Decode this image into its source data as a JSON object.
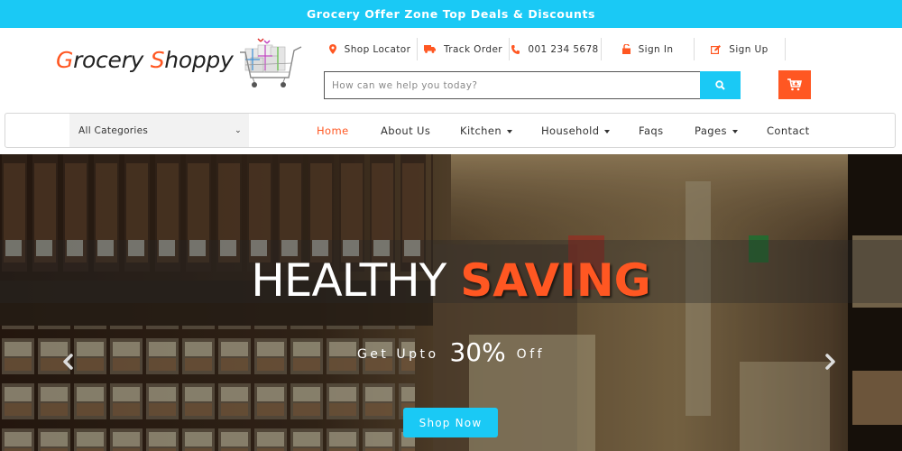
{
  "offer_bar": {
    "text": "Grocery Offer Zone Top Deals & Discounts"
  },
  "header": {
    "logo": {
      "first_initial": "G",
      "first_rest": "rocery ",
      "second_initial": "S",
      "second_rest": "hoppy",
      "icon": "shopping-cart-gifts-image"
    },
    "top_links": [
      {
        "label": "Shop Locator",
        "icon": "map-marker-icon"
      },
      {
        "label": "Track Order",
        "icon": "truck-icon"
      },
      {
        "label": "001 234 5678",
        "icon": "phone-icon"
      },
      {
        "label": "Sign In",
        "icon": "unlock-icon"
      },
      {
        "label": "Sign Up",
        "icon": "edit-icon"
      }
    ],
    "search": {
      "placeholder": "How can we help you today?",
      "value": "",
      "button_icon": "search-icon"
    },
    "cart_button_icon": "cart-add-icon"
  },
  "nav": {
    "category_select": {
      "selected": "All Categories"
    },
    "items": [
      {
        "label": "Home",
        "active": true,
        "dropdown": false
      },
      {
        "label": "About Us",
        "active": false,
        "dropdown": false
      },
      {
        "label": "Kitchen",
        "active": false,
        "dropdown": true
      },
      {
        "label": "Household",
        "active": false,
        "dropdown": true
      },
      {
        "label": "Faqs",
        "active": false,
        "dropdown": false
      },
      {
        "label": "Pages",
        "active": false,
        "dropdown": true
      },
      {
        "label": "Contact",
        "active": false,
        "dropdown": false
      }
    ]
  },
  "hero": {
    "headline_part1": "HEALTHY",
    "headline_part2": "SAVING",
    "sub_prefix": "Get Upto",
    "sub_value": "30%",
    "sub_suffix": "Off",
    "cta_label": "Shop Now",
    "prev_icon": "chevron-left-icon",
    "next_icon": "chevron-right-icon"
  },
  "colors": {
    "accent_blue": "#1ac9f5",
    "accent_orange": "#ff5722",
    "text_dark": "#333333"
  }
}
